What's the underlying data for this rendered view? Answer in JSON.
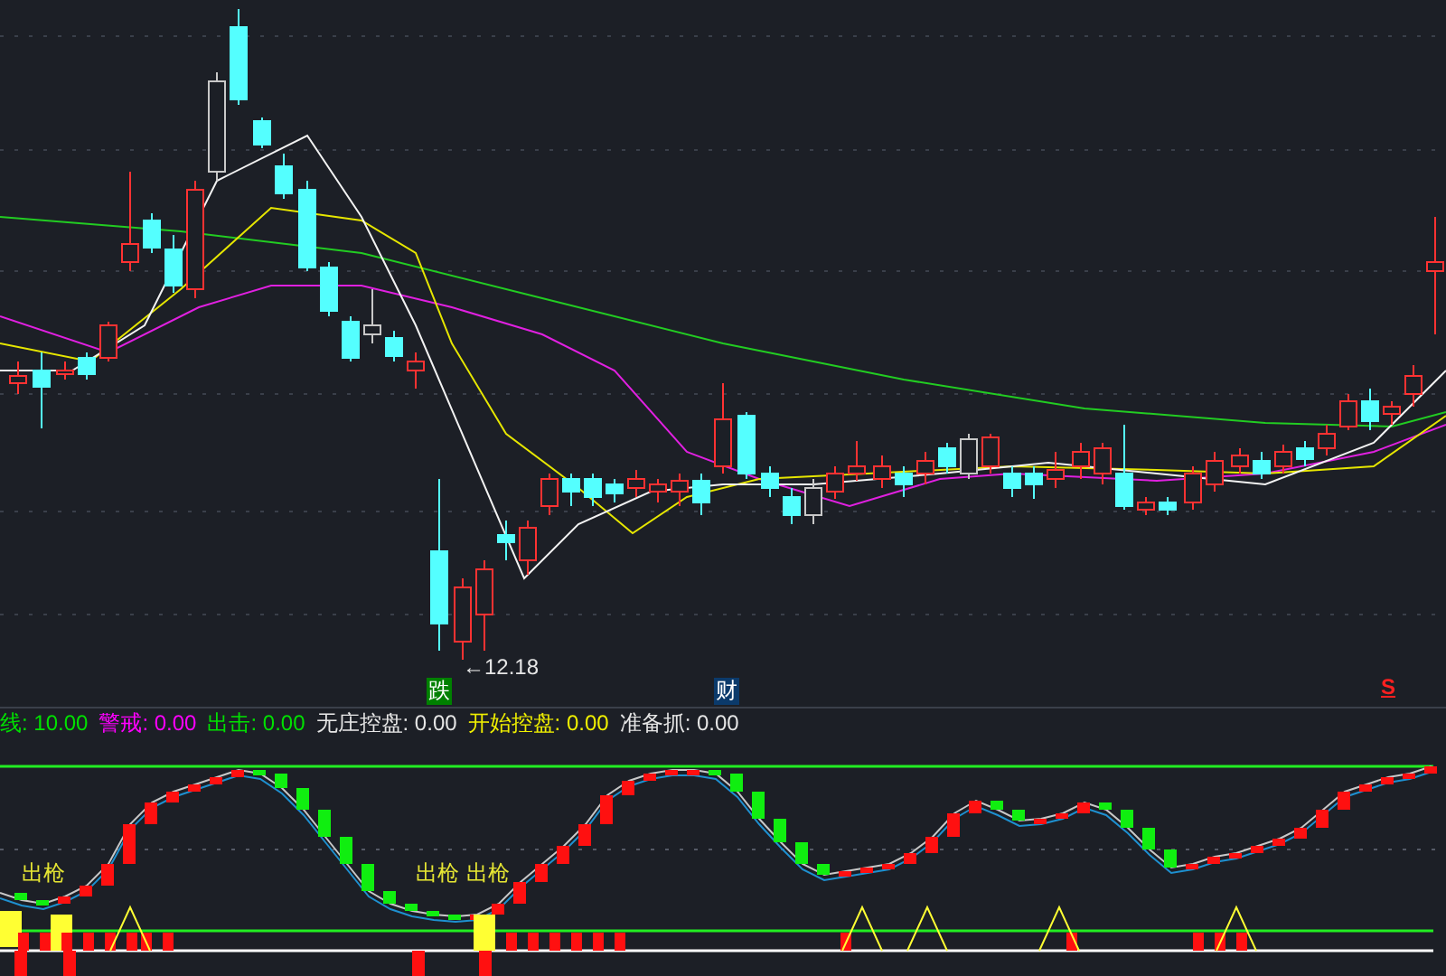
{
  "main_chart": {
    "low_marker": "←12.18",
    "event_markers": [
      {
        "label": "跌",
        "color": "#008000"
      },
      {
        "label": "财",
        "color": "#0b3a6b"
      }
    ],
    "sell_signal": "S"
  },
  "indicator_legend": [
    {
      "label": "线:",
      "value": "10.00",
      "color": "#00e000"
    },
    {
      "label": "警戒:",
      "value": "0.00",
      "color": "#ff00ff"
    },
    {
      "label": "出击:",
      "value": "0.00",
      "color": "#00e000"
    },
    {
      "label": "无庄控盘:",
      "value": "0.00",
      "color": "#e6e6e6"
    },
    {
      "label": "开始控盘:",
      "value": "0.00",
      "color": "#f0f000"
    },
    {
      "label": "准备抓:",
      "value": "0.00",
      "color": "#e6e6e6"
    }
  ],
  "indicator_chart": {
    "signals": [
      {
        "label": "出枪"
      },
      {
        "label": "出枪"
      },
      {
        "label": "出枪"
      }
    ]
  }
}
